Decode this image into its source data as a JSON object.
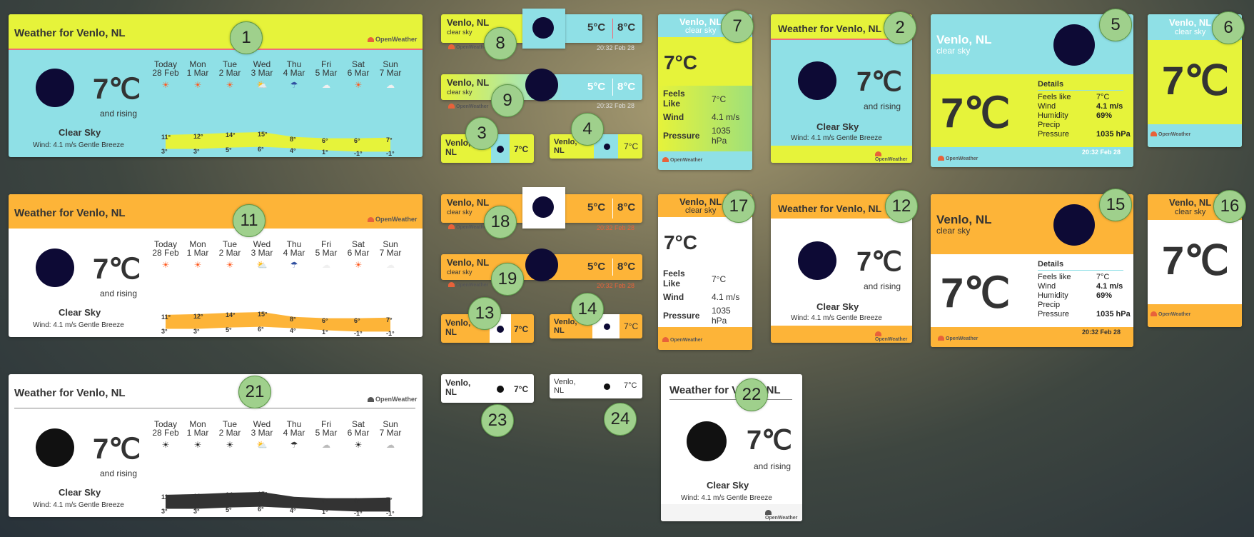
{
  "location": "Venlo, NL",
  "header_title": "Weather for Venlo, NL",
  "temp": "7℃",
  "temp_c": "7°C",
  "and_rising": "and rising",
  "condition": "Clear Sky",
  "condition_small": "clear sky",
  "wind": "Wind: 4.1 m/s Gentle Breeze",
  "brand": "OpenWeather",
  "timestamp": "20:32 Feb 28",
  "min_temp": "5°C",
  "max_temp": "8°C",
  "feels_like_label": "Feels Like",
  "feels_like_label_short": "Feels like",
  "wind_label": "Wind",
  "wind_value": "4.1 m/s",
  "pressure_label": "Pressure",
  "pressure_value": "1035 hPa",
  "humidity_label": "Humidity",
  "humidity_value": "69%",
  "precip_label": "Precip",
  "details_label": "Details",
  "forecast": [
    {
      "d1": "Today",
      "d2": "28 Feb",
      "icon": "sun-icon",
      "hi": "11°",
      "lo": "3°"
    },
    {
      "d1": "Mon",
      "d2": "1 Mar",
      "icon": "sun-icon",
      "hi": "12°",
      "lo": "3°"
    },
    {
      "d1": "Tue",
      "d2": "2 Mar",
      "icon": "sun-icon",
      "hi": "14°",
      "lo": "5°"
    },
    {
      "d1": "Wed",
      "d2": "3 Mar",
      "icon": "cloud-sun-icon",
      "hi": "15°",
      "lo": "6°"
    },
    {
      "d1": "Thu",
      "d2": "4 Mar",
      "icon": "rain-icon",
      "hi": "8°",
      "lo": "4°"
    },
    {
      "d1": "Fri",
      "d2": "5 Mar",
      "icon": "cloud-icon",
      "hi": "6°",
      "lo": "1°"
    },
    {
      "d1": "Sat",
      "d2": "6 Mar",
      "icon": "sun-icon",
      "hi": "6°",
      "lo": "-1°"
    },
    {
      "d1": "Sun",
      "d2": "7 Mar",
      "icon": "cloud-icon",
      "hi": "7°",
      "lo": "-1°"
    }
  ],
  "badges": [
    "1",
    "2",
    "3",
    "4",
    "5",
    "6",
    "7",
    "8",
    "9",
    "11",
    "12",
    "13",
    "14",
    "15",
    "16",
    "17",
    "18",
    "19",
    "21",
    "22",
    "23",
    "24"
  ],
  "colors": {
    "yellow": "#e6f33a",
    "cyan": "#8fe0e6",
    "orange": "#fdb438",
    "white": "#ffffff",
    "sun": "#0d0a35",
    "black": "#111111",
    "accent": "#e8623a"
  }
}
